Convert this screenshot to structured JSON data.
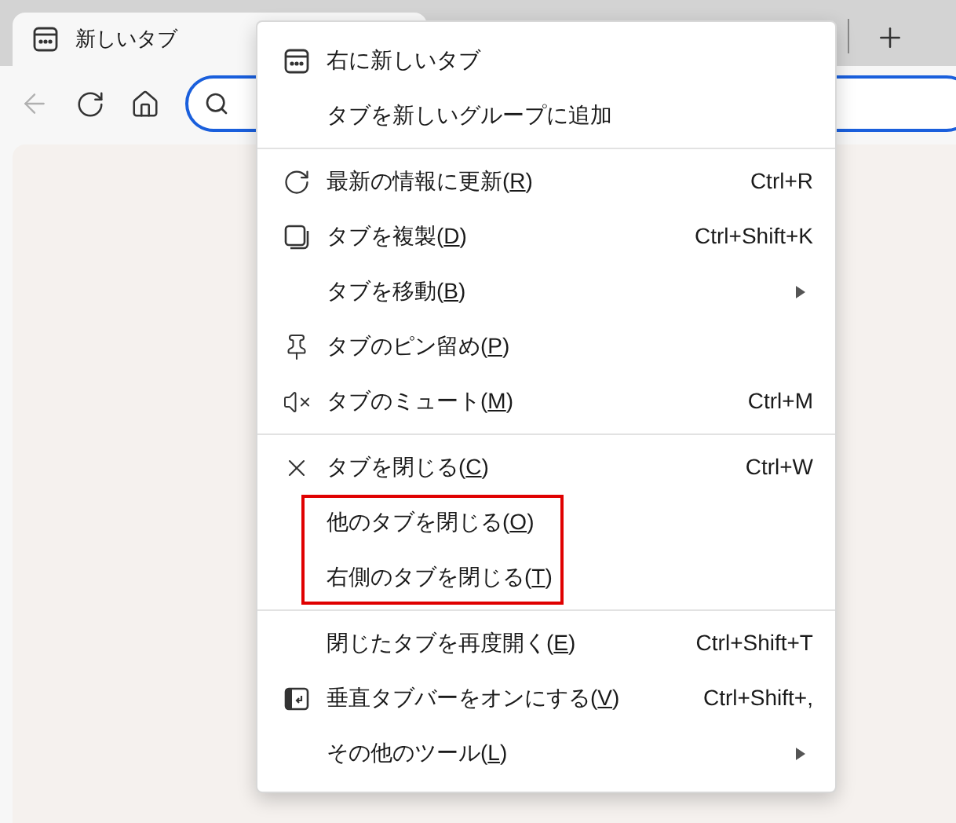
{
  "browser": {
    "tab": {
      "title": "新しいタブ",
      "selected": true
    },
    "back_disabled": true
  },
  "context_menu": {
    "sections": [
      {
        "items": [
          {
            "label": [
              "右に新しいタブ"
            ],
            "highlighted": false
          },
          {
            "label": [
              "タブを新しいグループに追加"
            ],
            "highlighted": false
          }
        ]
      },
      {
        "items": [
          {
            "label": [
              "最新の情報に更新(",
              "R",
              ")"
            ],
            "shortcut": "Ctrl+R",
            "highlighted": false
          },
          {
            "label": [
              "タブを複製(",
              "D",
              ")"
            ],
            "shortcut": "Ctrl+Shift+K",
            "highlighted": false
          },
          {
            "label": [
              "タブを移動(",
              "B",
              ")"
            ],
            "submenu": true,
            "highlighted": false
          },
          {
            "label": [
              "タブのピン留め(",
              "P",
              ")"
            ],
            "highlighted": false
          },
          {
            "label": [
              "タブのミュート(",
              "M",
              ")"
            ],
            "shortcut": "Ctrl+M",
            "highlighted": false
          }
        ]
      },
      {
        "items": [
          {
            "label": [
              "タブを閉じる(",
              "C",
              ")"
            ],
            "shortcut": "Ctrl+W",
            "highlighted": false
          },
          {
            "label": [
              "他のタブを閉じる(",
              "O",
              ")"
            ],
            "highlighted": true
          },
          {
            "label": [
              "右側のタブを閉じる(",
              "T",
              ")"
            ],
            "highlighted": true
          }
        ]
      },
      {
        "items": [
          {
            "label": [
              "閉じたタブを再度開く(",
              "E",
              ")"
            ],
            "shortcut": "Ctrl+Shift+T",
            "highlighted": false
          },
          {
            "label": [
              "垂直タブバーをオンにする(",
              "V",
              ")"
            ],
            "shortcut": "Ctrl+Shift+,",
            "highlighted": false
          },
          {
            "label": [
              "その他のツール(",
              "L",
              ")"
            ],
            "submenu": true,
            "highlighted": false
          }
        ]
      }
    ]
  }
}
